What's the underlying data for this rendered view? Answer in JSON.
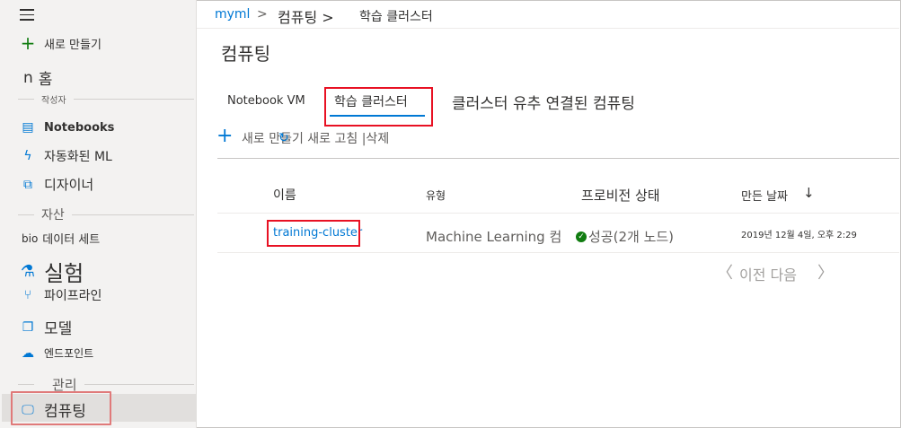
{
  "sidebar": {
    "new_label": "새로 만들기",
    "home_prefix": "n",
    "home_label": "홈",
    "section_author": "작성자",
    "notebooks": "Notebooks",
    "automl": "자동화된 ML",
    "designer": "디자이너",
    "section_assets": "자산",
    "datasets_prefix": "bio",
    "datasets": "데이터 세트",
    "experiments": "실험",
    "pipelines": "파이프라인",
    "models": "모델",
    "endpoints": "엔드포인트",
    "section_manage": "관리",
    "compute": "컴퓨팅"
  },
  "breadcrumb": {
    "workspace": "myml",
    "sep1": ">",
    "compute": "컴퓨팅 >",
    "current": "학습 클러스터"
  },
  "page": {
    "title": "컴퓨팅"
  },
  "tabs": {
    "notebook_vm": "Notebook VM",
    "training_clusters": "학습 클러스터",
    "inference_clusters": "클러스터 유추 연결된 컴퓨팅"
  },
  "commands": {
    "new_refresh_delete": "새로 만들기 새로 고침 |삭제"
  },
  "table": {
    "headers": {
      "name": "이름",
      "type": "유형",
      "provisioning_state": "프로비전 상태",
      "created": "만든 날짜",
      "sort_arrow": "↓"
    },
    "rows": [
      {
        "name": "training-cluster",
        "type": "Machine  Learning 컴",
        "state": "성공(2개 노드)",
        "created": "2019년 12월 4일, 오후 2:29"
      }
    ]
  },
  "pager": {
    "prev_chevron": "〈",
    "label": "이전 다음",
    "next_chevron": "〉"
  },
  "colors": {
    "accent": "#0078d4",
    "highlight_border": "#e81123",
    "success": "#107c10",
    "sidebar_bg": "#f3f2f1"
  }
}
